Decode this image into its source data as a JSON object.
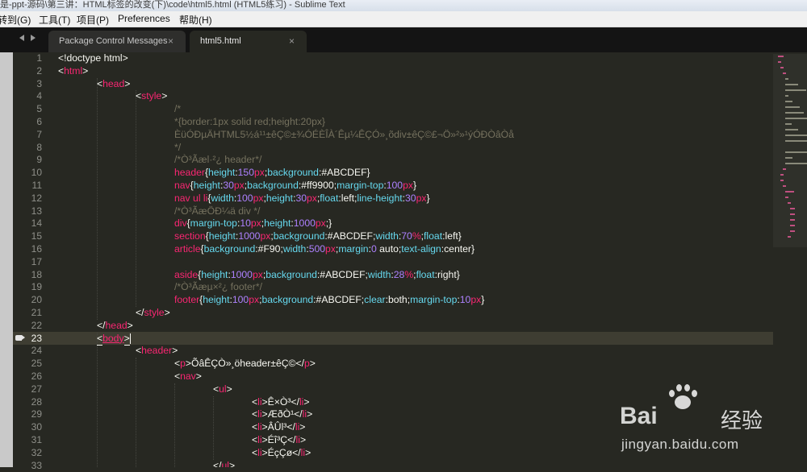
{
  "window": {
    "title": "是-ppt-源码\\第三讲：HTML标签的改变(下)\\code\\html5.html (HTML5练习) - Sublime Text"
  },
  "menu": [
    "转到(G)",
    "工具(T)",
    "项目(P)",
    "Preferences",
    "帮助(H)"
  ],
  "tabs": [
    {
      "label": "Package Control Messages",
      "active": false
    },
    {
      "label": "html5.html",
      "active": true
    }
  ],
  "editor": {
    "current_line": 23,
    "lines": [
      {
        "n": 1,
        "text": "<!doctype html>"
      },
      {
        "n": 2,
        "text": "<html>"
      },
      {
        "n": 3,
        "text": "<head>"
      },
      {
        "n": 4,
        "text": "<style>"
      },
      {
        "n": 5,
        "text": "/*"
      },
      {
        "n": 6,
        "text": "*{border:1px solid red;height:20px}"
      },
      {
        "n": 7,
        "text": "ÈüÓÐµÄHTML5½á¹¹±êÇ©±¾ÓÉÈÎÀ´Êµ¼ÊÇÓ»¸õdiv±êÇ©£¬Ö»²»¹ýÓÐÒâÒå"
      },
      {
        "n": 8,
        "text": "*/"
      },
      {
        "n": 9,
        "text": "/*Ò³Ãæl·²¿ header*/"
      },
      {
        "n": 10,
        "text": "header{height:150px;background:#ABCDEF}"
      },
      {
        "n": 11,
        "text": "nav{height:30px;background:#ff9900;margin-top:100px}"
      },
      {
        "n": 12,
        "text": "nav ul li{width:100px;height:30px;float:left;line-height:30px}"
      },
      {
        "n": 13,
        "text": "/*Ò³ÃæÖÐ¼ä div */"
      },
      {
        "n": 14,
        "text": "div{margin-top:10px;height:1000px;}"
      },
      {
        "n": 15,
        "text": "section{height:1000px;background:#ABCDEF;width:70%;float:left}"
      },
      {
        "n": 16,
        "text": "article{background:#F90;width:500px;margin:0 auto;text-align:center}"
      },
      {
        "n": 17,
        "text": ""
      },
      {
        "n": 18,
        "text": "aside{height:1000px;background:#ABCDEF;width:28%;float:right}"
      },
      {
        "n": 19,
        "text": "/*Ò³Ãæµ×²¿ footer*/"
      },
      {
        "n": 20,
        "text": "footer{height:100px;background:#ABCDEF;clear:both;margin-top:10px}"
      },
      {
        "n": 21,
        "text": "</style>"
      },
      {
        "n": 22,
        "text": "</head>"
      },
      {
        "n": 23,
        "text": "<body>"
      },
      {
        "n": 24,
        "text": "<header>"
      },
      {
        "n": 25,
        "text": "<p>ÕâÊÇÒ»¸öheader±êÇ©</p>"
      },
      {
        "n": 26,
        "text": "<nav>"
      },
      {
        "n": 27,
        "text": "<ul>"
      },
      {
        "n": 28,
        "text": "<li>Ê×Ò³</li>"
      },
      {
        "n": 29,
        "text": "<li>ÆðÒ¹</li>"
      },
      {
        "n": 30,
        "text": "<li>ÂÛl³</li>"
      },
      {
        "n": 31,
        "text": "<li>Éî³Ç</li>"
      },
      {
        "n": 32,
        "text": "<li>ÉçÇø</li>"
      },
      {
        "n": 33,
        "text": "</ul>"
      }
    ]
  },
  "watermark": {
    "logo": "Bai",
    "logo_cn": "经验",
    "url": "jingyan.baidu.com"
  },
  "colors": {
    "bg": "#272822",
    "tag": "#f92672",
    "comment": "#75715e",
    "property": "#66d9ef",
    "number": "#ae81ff",
    "text": "#f8f8f2"
  }
}
